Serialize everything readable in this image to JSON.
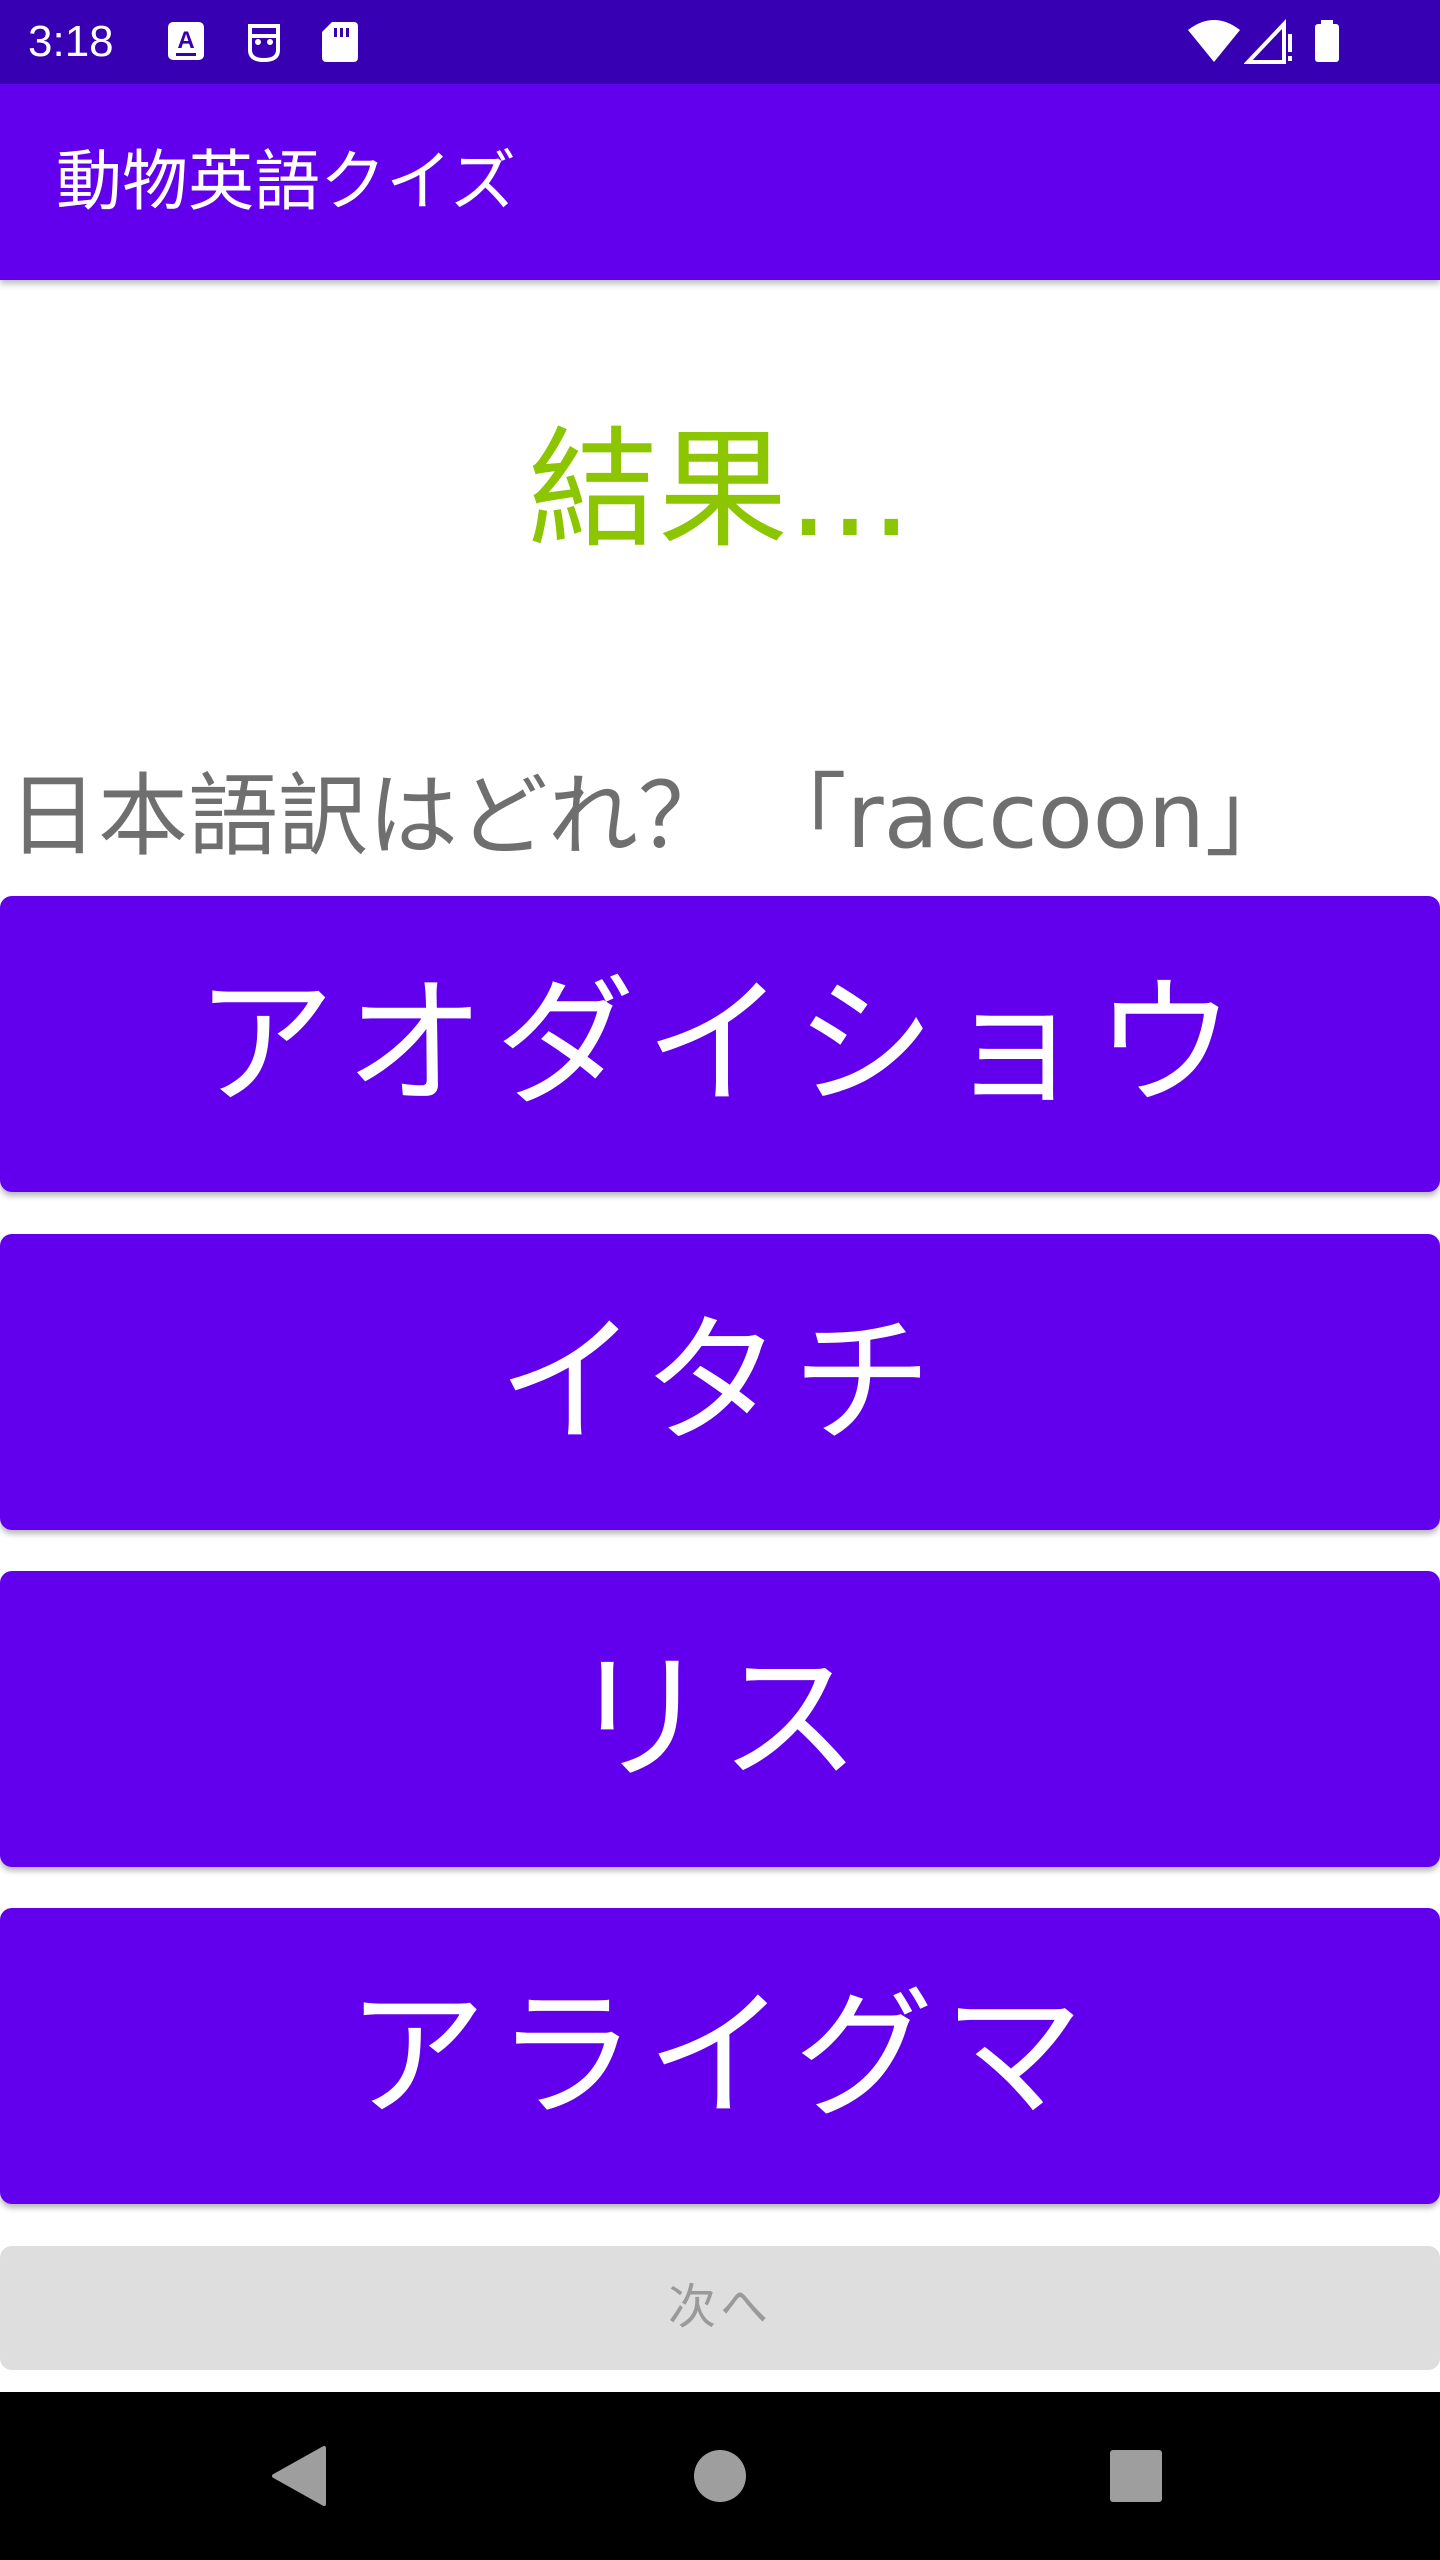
{
  "status_bar": {
    "time": "3:18",
    "icons": [
      "keyboard-a-icon",
      "robot-icon",
      "sd-card-icon",
      "wifi-icon",
      "signal-icon",
      "battery-icon"
    ]
  },
  "app_bar": {
    "title": "動物英語クイズ"
  },
  "result": {
    "text": "結果...",
    "color": "#8BC600"
  },
  "question": {
    "text": "日本語訳はどれ？ 「raccoon」"
  },
  "choices": [
    {
      "label": "アオダイショウ"
    },
    {
      "label": "イタチ"
    },
    {
      "label": "リス"
    },
    {
      "label": "アライグマ"
    }
  ],
  "next_button": {
    "label": "次へ",
    "enabled": false
  },
  "nav_bar": {
    "buttons": [
      "back-icon",
      "home-icon",
      "recents-icon"
    ]
  },
  "colors": {
    "status_bar": "#3700B3",
    "primary": "#6200EE",
    "disabled_button": "#DEDEDE"
  }
}
